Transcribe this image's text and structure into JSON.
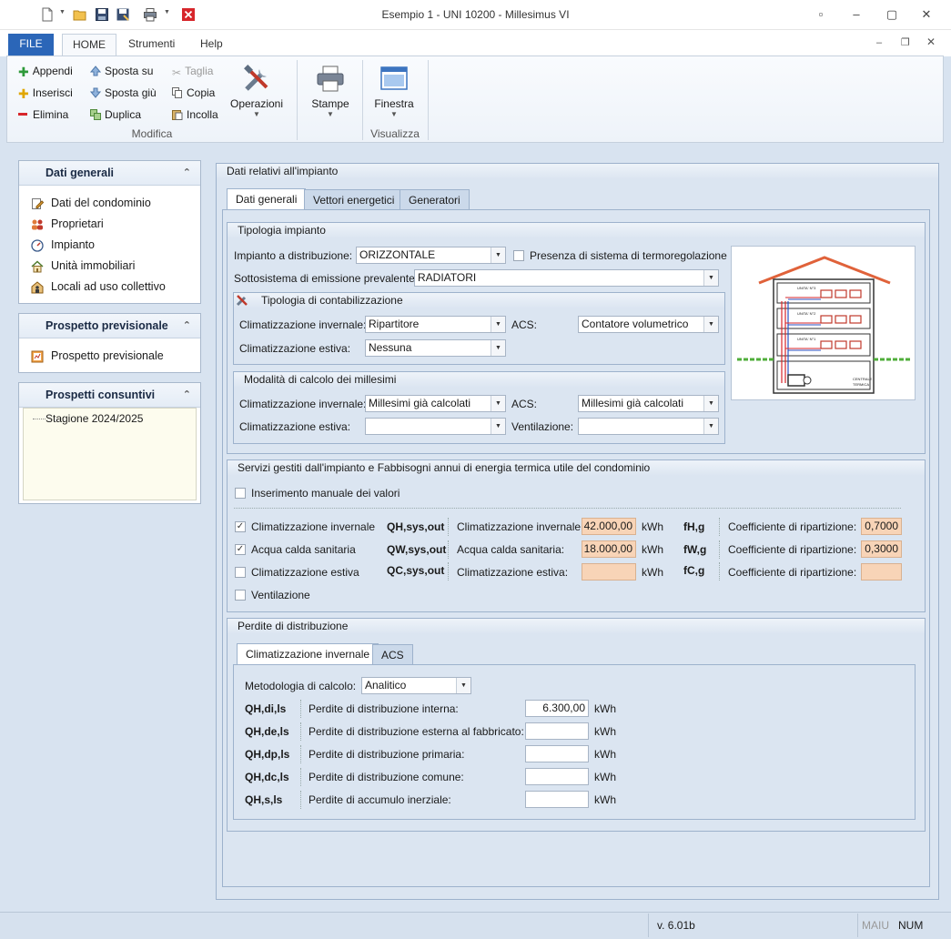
{
  "window": {
    "title": "Esempio 1 - UNI 10200 - Millesimus VI",
    "controls": [
      "▫",
      "–",
      "▢",
      "✕"
    ]
  },
  "ribbon_tabs": [
    "FILE",
    "HOME",
    "Strumenti",
    "Help"
  ],
  "ribbon": {
    "modifica": {
      "append": "Appendi",
      "insert": "Inserisci",
      "delete": "Elimina",
      "move_up": "Sposta su",
      "move_down": "Sposta giù",
      "duplicate": "Duplica",
      "cut": "Taglia",
      "copy": "Copia",
      "paste": "Incolla",
      "operations": "Operazioni",
      "group_label": "Modifica"
    },
    "print": "Stampe",
    "window": "Finestra",
    "visualizza_label": "Visualizza"
  },
  "left": {
    "dati_generali": {
      "title": "Dati generali",
      "items": [
        "Dati del condominio",
        "Proprietari",
        "Impianto",
        "Unità immobiliari",
        "Locali ad uso collettivo"
      ]
    },
    "prospetto": {
      "title": "Prospetto previsionale",
      "items": [
        "Prospetto previsionale"
      ]
    },
    "consuntivi": {
      "title": "Prospetti consuntivi",
      "items": [
        "Stagione 2024/2025"
      ]
    }
  },
  "main": {
    "title": "Dati relativi all'impianto",
    "tabs": [
      "Dati generali",
      "Vettori energetici",
      "Generatori"
    ],
    "tipologia": {
      "title": "Tipologia impianto",
      "distribuzione_label": "Impianto a distribuzione:",
      "distribuzione_value": "ORIZZONTALE",
      "termoreg_label": "Presenza di sistema di termoregolazione",
      "emissione_label": "Sottosistema di emissione prevalente:",
      "emissione_value": "RADIATORI",
      "contab": {
        "title": "Tipologia di contabilizzazione",
        "inv_label": "Climatizzazione invernale:",
        "inv_value": "Ripartitore",
        "acs_label": "ACS:",
        "acs_value": "Contatore volumetrico",
        "est_label": "Climatizzazione estiva:",
        "est_value": "Nessuna"
      },
      "millesimi": {
        "title": "Modalità di calcolo dei millesimi",
        "inv_label": "Climatizzazione invernale:",
        "inv_value": "Millesimi già calcolati",
        "acs_label": "ACS:",
        "acs_value": "Millesimi già calcolati",
        "est_label": "Climatizzazione estiva:",
        "est_value": "",
        "vent_label": "Ventilazione:",
        "vent_value": ""
      },
      "diagram": {
        "unit1": "UNITA' N°3",
        "unit2": "UNITA' N°2",
        "unit3": "UNITA' N°1",
        "centrale": "CENTRALE",
        "termica": "TERMICA"
      }
    },
    "servizi": {
      "title": "Servizi gestiti dall'impianto e Fabbisogni annui di energia termica utile del condominio",
      "manual_label": "Inserimento manuale dei valori",
      "rows": [
        {
          "check": "Climatizzazione invernale",
          "checked": true,
          "sym": "QH,sys,out",
          "label": "Climatizzazione invernale:",
          "value": "42.000,00",
          "unit": "kWh",
          "fsym": "fH,g",
          "coef_label": "Coefficiente di ripartizione:",
          "coef": "0,7000"
        },
        {
          "check": "Acqua calda sanitaria",
          "checked": true,
          "sym": "QW,sys,out",
          "label": "Acqua calda sanitaria:",
          "value": "18.000,00",
          "unit": "kWh",
          "fsym": "fW,g",
          "coef_label": "Coefficiente di ripartizione:",
          "coef": "0,3000"
        },
        {
          "check": "Climatizzazione estiva",
          "checked": false,
          "sym": "QC,sys,out",
          "label": "Climatizzazione estiva:",
          "value": "",
          "unit": "kWh",
          "fsym": "fC,g",
          "coef_label": "Coefficiente di ripartizione:",
          "coef": ""
        },
        {
          "check": "Ventilazione",
          "checked": false
        }
      ]
    },
    "perdite": {
      "title": "Perdite di distribuzione",
      "tabs": [
        "Climatizzazione invernale",
        "ACS"
      ],
      "metodologia_label": "Metodologia di calcolo:",
      "metodologia_value": "Analitico",
      "rows": [
        {
          "sym": "QH,di,ls",
          "label": "Perdite di distribuzione interna:",
          "value": "6.300,00",
          "unit": "kWh"
        },
        {
          "sym": "QH,de,ls",
          "label": "Perdite di distribuzione esterna al fabbricato:",
          "value": "",
          "unit": "kWh"
        },
        {
          "sym": "QH,dp,ls",
          "label": "Perdite di distribuzione primaria:",
          "value": "",
          "unit": "kWh"
        },
        {
          "sym": "QH,dc,ls",
          "label": "Perdite di distribuzione comune:",
          "value": "",
          "unit": "kWh"
        },
        {
          "sym": "QH,s,ls",
          "label": "Perdite di accumulo inerziale:",
          "value": "",
          "unit": "kWh"
        }
      ]
    }
  },
  "status": {
    "version": "v. 6.01b",
    "caps": "MAIU",
    "num": "NUM"
  },
  "colors": {
    "accent": "#2b66b8",
    "orange_field": "#f8d4b7",
    "panel_bg": "#dbe5f1"
  }
}
